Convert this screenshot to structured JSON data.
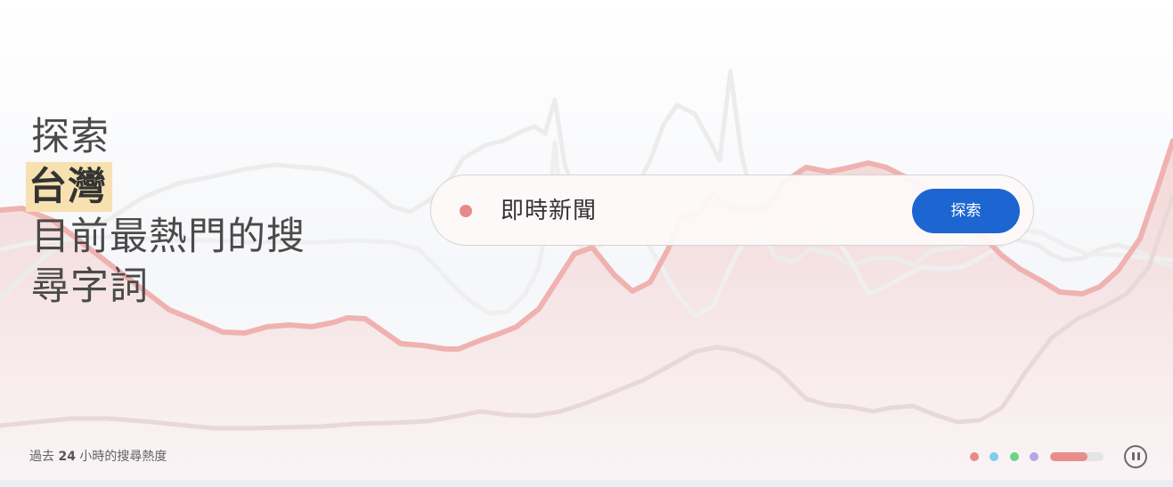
{
  "hero": {
    "headline": {
      "line1": "探索",
      "region": "台灣",
      "line3": "目前最熱門的搜",
      "line4": "尋字詞"
    },
    "search_pill": {
      "term": "即時新聞",
      "button_label": "探索",
      "dot_color": "#e98a8a"
    },
    "caption": {
      "prefix": "過去",
      "hours": "24",
      "suffix": "小時的搜尋熱度"
    },
    "carousel": {
      "dot_colors": [
        "#e98a8a",
        "#7fcdf0",
        "#6fd386",
        "#b6a5e8"
      ],
      "progress": 0.7,
      "pause_icon": "pause-icon"
    }
  },
  "colors": {
    "accent": "#1d65d1",
    "highlight": "#f7e1b0",
    "trend_line": "#efb2b0"
  }
}
